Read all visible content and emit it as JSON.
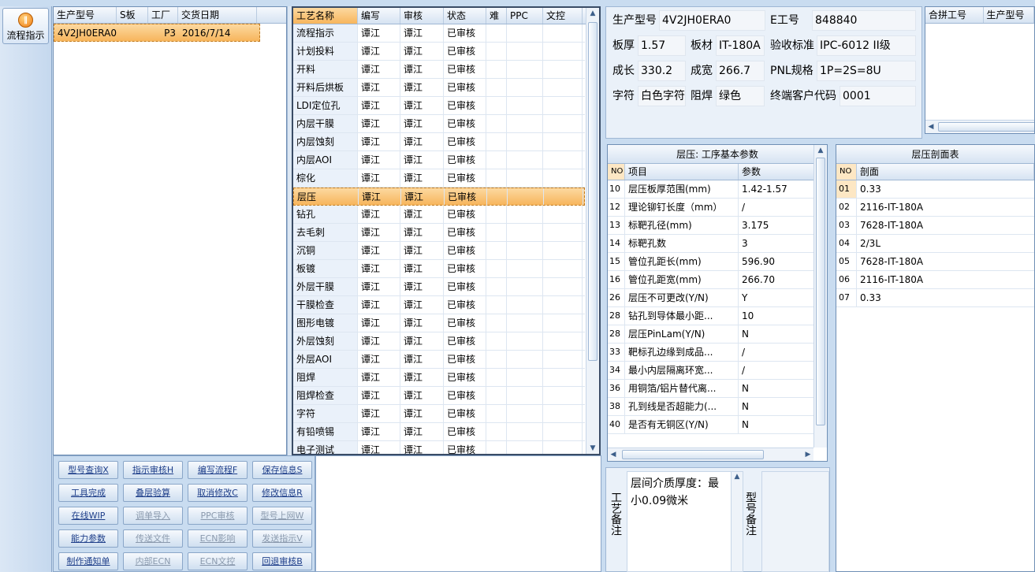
{
  "sidebar": {
    "label": "流程指示"
  },
  "orders": {
    "headers": [
      "生产型号",
      "S板",
      "工厂",
      "交货日期"
    ],
    "rows": [
      [
        "4V2JH0ERA0",
        "",
        "P3",
        "2016/7/14"
      ]
    ]
  },
  "process": {
    "headers": [
      "工艺名称",
      "编写",
      "审核",
      "状态",
      "难",
      "PPC",
      "文控"
    ],
    "rows": [
      [
        "流程指示",
        "谭江",
        "谭江",
        "已审核"
      ],
      [
        "计划投料",
        "谭江",
        "谭江",
        "已审核"
      ],
      [
        "开料",
        "谭江",
        "谭江",
        "已审核"
      ],
      [
        "开料后烘板",
        "谭江",
        "谭江",
        "已审核"
      ],
      [
        "LDI定位孔",
        "谭江",
        "谭江",
        "已审核"
      ],
      [
        "内层干膜",
        "谭江",
        "谭江",
        "已审核"
      ],
      [
        "内层蚀刻",
        "谭江",
        "谭江",
        "已审核"
      ],
      [
        "内层AOI",
        "谭江",
        "谭江",
        "已审核"
      ],
      [
        "棕化",
        "谭江",
        "谭江",
        "已审核"
      ],
      [
        "层压",
        "谭江",
        "谭江",
        "已审核"
      ],
      [
        "钻孔",
        "谭江",
        "谭江",
        "已审核"
      ],
      [
        "去毛刺",
        "谭江",
        "谭江",
        "已审核"
      ],
      [
        "沉铜",
        "谭江",
        "谭江",
        "已审核"
      ],
      [
        "板镀",
        "谭江",
        "谭江",
        "已审核"
      ],
      [
        "外层干膜",
        "谭江",
        "谭江",
        "已审核"
      ],
      [
        "干膜检查",
        "谭江",
        "谭江",
        "已审核"
      ],
      [
        "图形电镀",
        "谭江",
        "谭江",
        "已审核"
      ],
      [
        "外层蚀刻",
        "谭江",
        "谭江",
        "已审核"
      ],
      [
        "外层AOI",
        "谭江",
        "谭江",
        "已审核"
      ],
      [
        "阻焊",
        "谭江",
        "谭江",
        "已审核"
      ],
      [
        "阻焊检查",
        "谭江",
        "谭江",
        "已审核"
      ],
      [
        "字符",
        "谭江",
        "谭江",
        "已审核"
      ],
      [
        "有铅喷锡",
        "谭江",
        "谭江",
        "已审核"
      ],
      [
        "电子测试",
        "谭江",
        "谭江",
        "已审核"
      ]
    ]
  },
  "buttons": [
    [
      "型号查询X",
      "指示审核H",
      "编写流程F",
      "保存信息S"
    ],
    [
      "工具完成",
      "叠层验算",
      "取消修改C",
      "修改信息R"
    ],
    [
      "在线WIP",
      "调单导入",
      "PPC审核",
      "型号上网W"
    ],
    [
      "能力参数",
      "传送文件",
      "ECN影响",
      "发送指示V"
    ],
    [
      "制作通知单",
      "内部ECN",
      "ECN文控",
      "回退审核B"
    ]
  ],
  "info": {
    "model_l": "生产型号",
    "model": "4V2JH0ERA0",
    "eno_l": "E工号",
    "eno": "848840",
    "thick_l": "板厚",
    "thick": "1.57",
    "mat_l": "板材",
    "mat": "IT-180A",
    "std_l": "验收标准",
    "std": "IPC-6012 II级",
    "len_l": "成长",
    "len": "330.2",
    "wid_l": "成宽",
    "wid": "266.7",
    "pnl_l": "PNL规格",
    "pnl": "1P=2S=8U",
    "char_l": "字符",
    "char": "白色字符",
    "mask_l": "阻焊",
    "mask": "绿色",
    "cust_l": "终端客户代码",
    "cust": "0001"
  },
  "merge": {
    "headers": [
      "合拼工号",
      "生产型号"
    ]
  },
  "params": {
    "title": "层压: 工序基本参数",
    "headers": [
      "NO",
      "项目",
      "参数"
    ],
    "rows": [
      [
        "10",
        "层压板厚范围(mm)",
        "1.42-1.57"
      ],
      [
        "12",
        "理论铆钉长度（mm）",
        "/"
      ],
      [
        "13",
        "标靶孔径(mm)",
        "3.175"
      ],
      [
        "14",
        "标靶孔数",
        "3"
      ],
      [
        "15",
        "管位孔距长(mm)",
        "596.90"
      ],
      [
        "16",
        "管位孔距宽(mm)",
        "266.70"
      ],
      [
        "26",
        "层压不可更改(Y/N)",
        "Y"
      ],
      [
        "28",
        "钻孔到导体最小距...",
        "10"
      ],
      [
        "28",
        "层压PinLam(Y/N)",
        "N"
      ],
      [
        "33",
        "靶标孔边缘到成品...",
        "/"
      ],
      [
        "34",
        "最小内层隔离环宽...",
        "/"
      ],
      [
        "36",
        "用铜箔/铝片替代离...",
        "N"
      ],
      [
        "38",
        "孔到线是否超能力(...",
        "N"
      ],
      [
        "40",
        "是否有无铜区(Y/N)",
        "N"
      ]
    ]
  },
  "stack": {
    "title": "层压剖面表",
    "headers": [
      "NO",
      "剖面"
    ],
    "rows": [
      [
        "01",
        "0.33"
      ],
      [
        "02",
        "2116-IT-180A"
      ],
      [
        "03",
        "7628-IT-180A"
      ],
      [
        "04",
        "2/3L"
      ],
      [
        "05",
        "7628-IT-180A"
      ],
      [
        "06",
        "2116-IT-180A"
      ],
      [
        "07",
        "0.33"
      ]
    ]
  },
  "remarks": {
    "proc_label": "工艺备注",
    "proc_text": "层间介质厚度：最小0.09微米",
    "model_label": "型号备注"
  }
}
